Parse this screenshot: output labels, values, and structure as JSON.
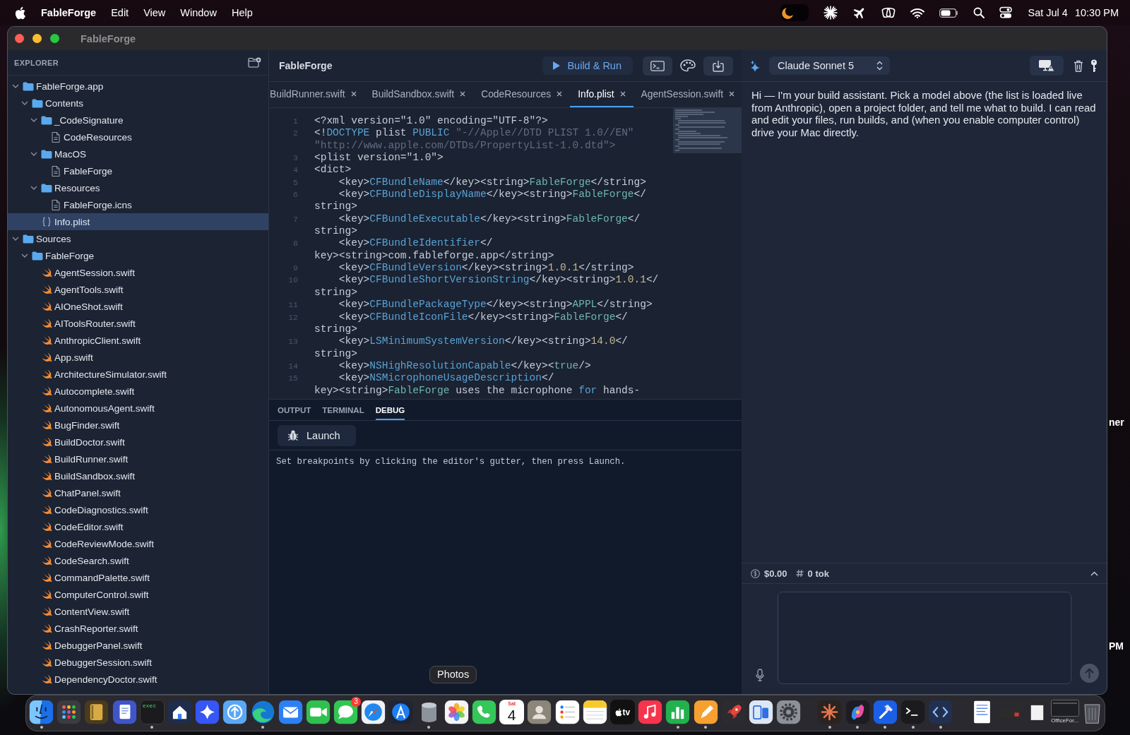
{
  "menu_bar": {
    "app_name": "FableForge",
    "menus": [
      "Edit",
      "View",
      "Window",
      "Help"
    ],
    "date": "Sat Jul 4",
    "time": "10:30 PM"
  },
  "window": {
    "title": "FableForge"
  },
  "explorer": {
    "title": "EXPLORER",
    "tree": [
      {
        "name": "FableForge.app",
        "kind": "folder",
        "expanded": true,
        "selected": false,
        "children": [
          {
            "name": "Contents",
            "kind": "folder",
            "expanded": true,
            "selected": false,
            "children": [
              {
                "name": "_CodeSignature",
                "kind": "folder",
                "expanded": true,
                "selected": false,
                "children": [
                  {
                    "name": "CodeResources",
                    "kind": "file",
                    "selected": false
                  }
                ]
              },
              {
                "name": "MacOS",
                "kind": "folder",
                "expanded": true,
                "selected": false,
                "children": [
                  {
                    "name": "FableForge",
                    "kind": "file",
                    "selected": false
                  }
                ]
              },
              {
                "name": "Resources",
                "kind": "folder",
                "expanded": true,
                "selected": false,
                "children": [
                  {
                    "name": "FableForge.icns",
                    "kind": "file",
                    "selected": false
                  }
                ]
              },
              {
                "name": "Info.plist",
                "kind": "plist",
                "selected": true
              }
            ]
          }
        ]
      },
      {
        "name": "Sources",
        "kind": "folder",
        "expanded": true,
        "selected": false,
        "children": [
          {
            "name": "FableForge",
            "kind": "folder",
            "expanded": true,
            "selected": false,
            "children": [
              {
                "name": "AgentSession.swift",
                "kind": "swift",
                "selected": false
              },
              {
                "name": "AgentTools.swift",
                "kind": "swift",
                "selected": false
              },
              {
                "name": "AIOneShot.swift",
                "kind": "swift",
                "selected": false
              },
              {
                "name": "AIToolsRouter.swift",
                "kind": "swift",
                "selected": false
              },
              {
                "name": "AnthropicClient.swift",
                "kind": "swift",
                "selected": false
              },
              {
                "name": "App.swift",
                "kind": "swift",
                "selected": false
              },
              {
                "name": "ArchitectureSimulator.swift",
                "kind": "swift",
                "selected": false
              },
              {
                "name": "Autocomplete.swift",
                "kind": "swift",
                "selected": false
              },
              {
                "name": "AutonomousAgent.swift",
                "kind": "swift",
                "selected": false
              },
              {
                "name": "BugFinder.swift",
                "kind": "swift",
                "selected": false
              },
              {
                "name": "BuildDoctor.swift",
                "kind": "swift",
                "selected": false
              },
              {
                "name": "BuildRunner.swift",
                "kind": "swift",
                "selected": false
              },
              {
                "name": "BuildSandbox.swift",
                "kind": "swift",
                "selected": false
              },
              {
                "name": "ChatPanel.swift",
                "kind": "swift",
                "selected": false
              },
              {
                "name": "CodeDiagnostics.swift",
                "kind": "swift",
                "selected": false
              },
              {
                "name": "CodeEditor.swift",
                "kind": "swift",
                "selected": false
              },
              {
                "name": "CodeReviewMode.swift",
                "kind": "swift",
                "selected": false
              },
              {
                "name": "CodeSearch.swift",
                "kind": "swift",
                "selected": false
              },
              {
                "name": "CommandPalette.swift",
                "kind": "swift",
                "selected": false
              },
              {
                "name": "ComputerControl.swift",
                "kind": "swift",
                "selected": false
              },
              {
                "name": "ContentView.swift",
                "kind": "swift",
                "selected": false
              },
              {
                "name": "CrashReporter.swift",
                "kind": "swift",
                "selected": false
              },
              {
                "name": "DebuggerPanel.swift",
                "kind": "swift",
                "selected": false
              },
              {
                "name": "DebuggerSession.swift",
                "kind": "swift",
                "selected": false
              },
              {
                "name": "DependencyDoctor.swift",
                "kind": "swift",
                "selected": false
              }
            ]
          }
        ]
      }
    ]
  },
  "editor": {
    "project": "FableForge",
    "run_button": "Build & Run",
    "tabs": [
      {
        "label": "BuildRunner.swift",
        "selected": false
      },
      {
        "label": "BuildSandbox.swift",
        "selected": false
      },
      {
        "label": "CodeResources",
        "selected": false
      },
      {
        "label": "Info.plist",
        "selected": true
      },
      {
        "label": "AgentSession.swift",
        "selected": false
      }
    ],
    "lines": [
      {
        "number": "1",
        "tokens": [
          {
            "kind": "tag",
            "text": "<?xml version=\"1.0\" encoding=\"UTF-8\"?>"
          }
        ]
      },
      {
        "number": "2",
        "tokens": [
          {
            "kind": "tag",
            "text": "<!"
          },
          {
            "kind": "name",
            "text": "DOCTYPE"
          },
          {
            "kind": "tag",
            "text": " plist "
          },
          {
            "kind": "name",
            "text": "PUBLIC"
          },
          {
            "kind": "dim",
            "text": " \"-//Apple//DTD PLIST 1.0//EN\" \"http://www.apple.com/DTDs/PropertyList-1.0.dtd\">"
          }
        ]
      },
      {
        "number": "3",
        "tokens": [
          {
            "kind": "tag",
            "text": "<plist version=\"1.0\">"
          }
        ]
      },
      {
        "number": "4",
        "tokens": [
          {
            "kind": "tag",
            "text": "<dict>"
          }
        ]
      },
      {
        "number": "5",
        "tokens": [
          {
            "kind": "tag",
            "text": "    <key>"
          },
          {
            "kind": "name",
            "text": "CFBundleName"
          },
          {
            "kind": "tag",
            "text": "</key><string>"
          },
          {
            "kind": "value",
            "text": "FableForge"
          },
          {
            "kind": "tag",
            "text": "</string>"
          }
        ]
      },
      {
        "number": "6",
        "tokens": [
          {
            "kind": "tag",
            "text": "    <key>"
          },
          {
            "kind": "name",
            "text": "CFBundleDisplayName"
          },
          {
            "kind": "tag",
            "text": "</key><string>"
          },
          {
            "kind": "value",
            "text": "FableForge"
          },
          {
            "kind": "tag",
            "text": "</string>"
          }
        ]
      },
      {
        "number": "7",
        "tokens": [
          {
            "kind": "tag",
            "text": "    <key>"
          },
          {
            "kind": "name",
            "text": "CFBundleExecutable"
          },
          {
            "kind": "tag",
            "text": "</key><string>"
          },
          {
            "kind": "value",
            "text": "FableForge"
          },
          {
            "kind": "tag",
            "text": "</string>"
          }
        ]
      },
      {
        "number": "8",
        "tokens": [
          {
            "kind": "tag",
            "text": "    <key>"
          },
          {
            "kind": "name",
            "text": "CFBundleIdentifier"
          },
          {
            "kind": "tag",
            "text": "</key><string>com.fableforge.app</string>"
          }
        ]
      },
      {
        "number": "9",
        "tokens": [
          {
            "kind": "tag",
            "text": "    <key>"
          },
          {
            "kind": "name",
            "text": "CFBundleVersion"
          },
          {
            "kind": "tag",
            "text": "</key><string>"
          },
          {
            "kind": "number",
            "text": "1.0.1"
          },
          {
            "kind": "tag",
            "text": "</string>"
          }
        ]
      },
      {
        "number": "10",
        "tokens": [
          {
            "kind": "tag",
            "text": "    <key>"
          },
          {
            "kind": "name",
            "text": "CFBundleShortVersionString"
          },
          {
            "kind": "tag",
            "text": "</key><string>"
          },
          {
            "kind": "number",
            "text": "1.0.1"
          },
          {
            "kind": "tag",
            "text": "</string>"
          }
        ]
      },
      {
        "number": "11",
        "tokens": [
          {
            "kind": "tag",
            "text": "    <key>"
          },
          {
            "kind": "name",
            "text": "CFBundlePackageType"
          },
          {
            "kind": "tag",
            "text": "</key><string>"
          },
          {
            "kind": "value",
            "text": "APPL"
          },
          {
            "kind": "tag",
            "text": "</string>"
          }
        ]
      },
      {
        "number": "12",
        "tokens": [
          {
            "kind": "tag",
            "text": "    <key>"
          },
          {
            "kind": "name",
            "text": "CFBundleIconFile"
          },
          {
            "kind": "tag",
            "text": "</key><string>"
          },
          {
            "kind": "value",
            "text": "FableForge"
          },
          {
            "kind": "tag",
            "text": "</string>"
          }
        ]
      },
      {
        "number": "13",
        "tokens": [
          {
            "kind": "tag",
            "text": "    <key>"
          },
          {
            "kind": "name",
            "text": "LSMinimumSystemVersion"
          },
          {
            "kind": "tag",
            "text": "</key><string>"
          },
          {
            "kind": "number",
            "text": "14.0"
          },
          {
            "kind": "tag",
            "text": "</string>"
          }
        ]
      },
      {
        "number": "14",
        "tokens": [
          {
            "kind": "tag",
            "text": "    <key>"
          },
          {
            "kind": "name",
            "text": "NSHighResolutionCapable"
          },
          {
            "kind": "tag",
            "text": "</key><"
          },
          {
            "kind": "value",
            "text": "true"
          },
          {
            "kind": "tag",
            "text": "/>"
          }
        ]
      },
      {
        "number": "15",
        "tokens": [
          {
            "kind": "tag",
            "text": "    <key>"
          },
          {
            "kind": "name",
            "text": "NSMicrophoneUsageDescription"
          },
          {
            "kind": "tag",
            "text": "</key><string>"
          },
          {
            "kind": "value",
            "text": "FableForge"
          },
          {
            "kind": "tag",
            "text": " uses the microphone "
          },
          {
            "kind": "name",
            "text": "for"
          },
          {
            "kind": "tag",
            "text": " hands-"
          }
        ]
      }
    ]
  },
  "bottom_panel": {
    "tabs": [
      {
        "label": "OUTPUT",
        "selected": false
      },
      {
        "label": "TERMINAL",
        "selected": false
      },
      {
        "label": "DEBUG",
        "selected": true
      }
    ],
    "launch_button": "Launch",
    "message": "Set breakpoints by clicking the editor's gutter, then press Launch."
  },
  "assistant": {
    "model": "Claude Sonnet 5",
    "message": "Hi — I'm your build assistant. Pick a model above (the list is loaded live from Anthropic), open a project folder, and tell me what to build. I can read and edit your files, run builds, and (when you enable computer control) drive your Mac directly.",
    "cost": "$0.00",
    "tokens": "0 tok"
  },
  "desktop": {
    "fragments": [
      "ner",
      "PM"
    ]
  },
  "tooltip": {
    "text": "Photos"
  },
  "dock": {
    "groups": [
      {
        "items": [
          {
            "kind": "finder",
            "running": true
          },
          {
            "kind": "launchpad",
            "running": false
          },
          {
            "kind": "notebook",
            "running": false
          },
          {
            "kind": "document",
            "running": false
          },
          {
            "kind": "exec",
            "label": "exec",
            "running": true
          },
          {
            "kind": "home",
            "running": false
          },
          {
            "kind": "sparkle",
            "running": false
          },
          {
            "kind": "upload",
            "running": false
          },
          {
            "kind": "browser",
            "running": true
          },
          {
            "kind": "mail",
            "running": false
          },
          {
            "kind": "video",
            "running": false
          },
          {
            "kind": "messages",
            "badge": "3",
            "running": false
          },
          {
            "kind": "compass",
            "running": false
          },
          {
            "kind": "drafting",
            "running": false
          },
          {
            "kind": "cylinder",
            "running": true
          },
          {
            "kind": "photos",
            "running": false
          },
          {
            "kind": "phone",
            "running": false
          },
          {
            "kind": "calendar",
            "sublabel": "Sat",
            "label": "4",
            "running": false
          },
          {
            "kind": "contacts",
            "running": false
          },
          {
            "kind": "reminders",
            "running": false
          },
          {
            "kind": "notes",
            "running": false
          },
          {
            "kind": "tv",
            "label": "tv",
            "running": false
          },
          {
            "kind": "music",
            "running": false
          },
          {
            "kind": "numbers",
            "running": true
          },
          {
            "kind": "pages",
            "running": true
          },
          {
            "kind": "rocket",
            "running": false
          },
          {
            "kind": "devices",
            "running": false
          },
          {
            "kind": "settings",
            "running": false
          }
        ]
      },
      {
        "items": [
          {
            "kind": "starburst",
            "running": true
          },
          {
            "kind": "ribbon",
            "running": true
          },
          {
            "kind": "hammer",
            "running": true
          },
          {
            "kind": "terminal",
            "running": true
          },
          {
            "kind": "code",
            "running": true
          }
        ]
      },
      {
        "items": [
          {
            "kind": "preview",
            "running": false
          },
          {
            "kind": "minimized",
            "running": false
          },
          {
            "kind": "page",
            "running": false
          },
          {
            "kind": "window",
            "caption": "OfficeFor...",
            "running": false
          },
          {
            "kind": "trash",
            "running": false
          }
        ]
      }
    ]
  }
}
